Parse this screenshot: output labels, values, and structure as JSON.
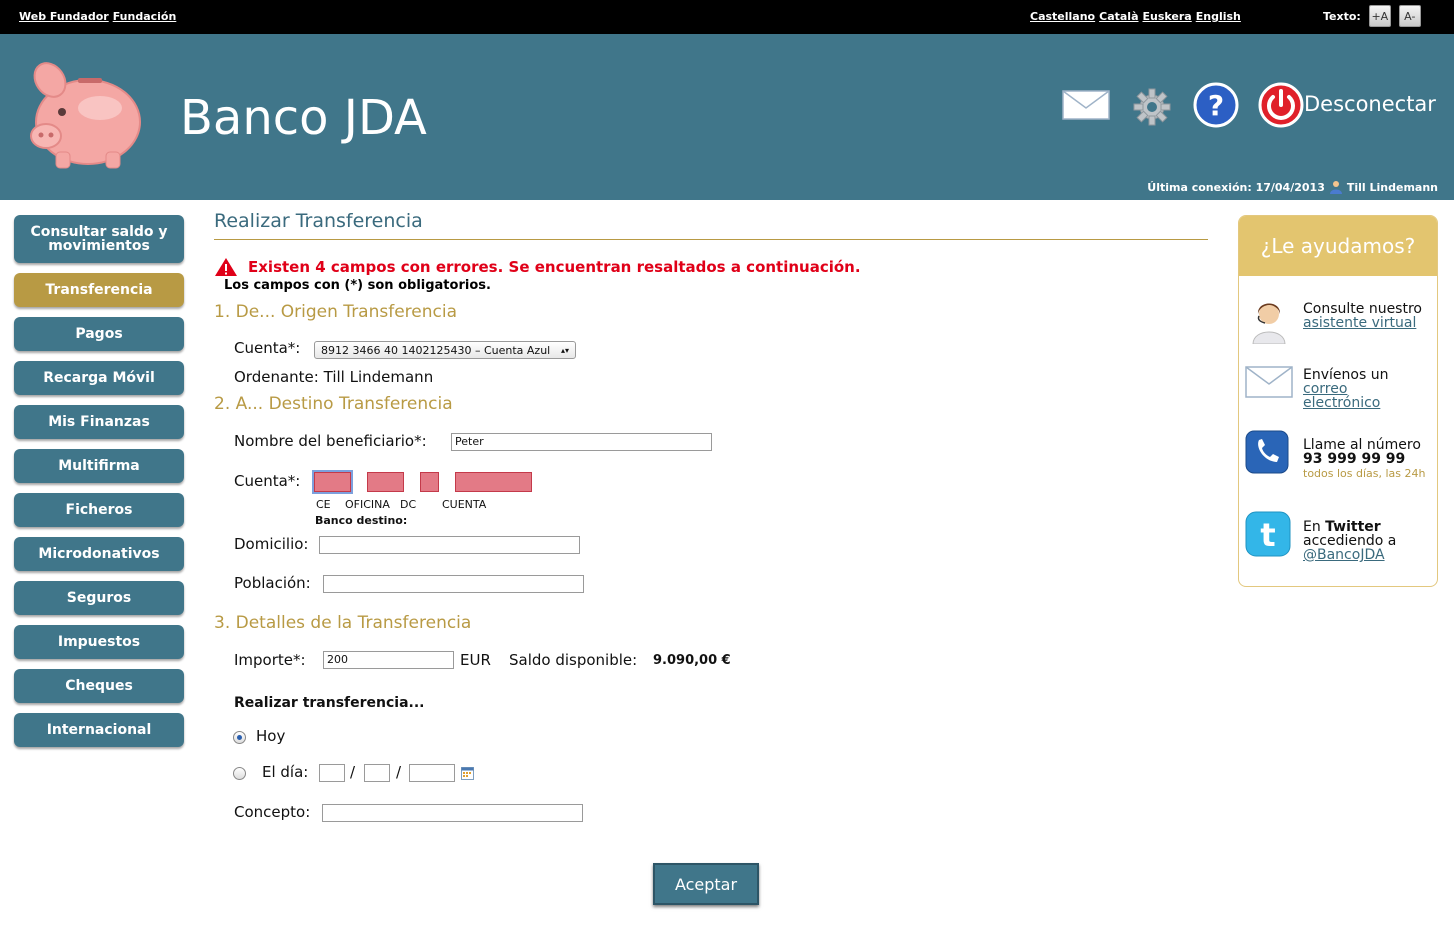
{
  "topbar": {
    "web_label": "Web Fundador",
    "foundation_label": "Fundación",
    "languages": [
      "Castellano",
      "Català",
      "Euskera",
      "English"
    ],
    "text_label": "Texto:",
    "text_increase": "+A",
    "text_decrease": "A-"
  },
  "header": {
    "bank_name": "Banco JDA",
    "logout_label": "Desconectar",
    "last_connection_label": "Última conexión: 17/04/2013",
    "user_name": "Till Lindemann"
  },
  "sidebar": {
    "items": [
      {
        "label": "Consultar saldo y movimientos"
      },
      {
        "label": "Transferencia"
      },
      {
        "label": "Pagos"
      },
      {
        "label": "Recarga Móvil"
      },
      {
        "label": "Mis Finanzas"
      },
      {
        "label": "Multifirma"
      },
      {
        "label": "Ficheros"
      },
      {
        "label": "Microdonativos"
      },
      {
        "label": "Seguros"
      },
      {
        "label": "Impuestos"
      },
      {
        "label": "Cheques"
      },
      {
        "label": "Internacional"
      }
    ],
    "active_index": 1
  },
  "main": {
    "title": "Realizar Transferencia",
    "error_message": "Existen 4 campos con errores. Se encuentran resaltados a continuación.",
    "required_note": "Los campos con (*) son obligatorios.",
    "section1": "1. De... Origen Transferencia",
    "cuenta_label": "Cuenta*:",
    "cuenta_value": "8912 3466 40 1402125430 – Cuenta Azul",
    "ordenante_label": "Ordenante:",
    "ordenante_value": "Till Lindemann",
    "section2": "2. A... Destino Transferencia",
    "beneficiario_label": "Nombre del beneficiario*:",
    "beneficiario_value": "Peter",
    "cuenta_dest_label": "Cuenta*:",
    "cuenta_parts": [
      "CE",
      "OFICINA",
      "DC",
      "CUENTA"
    ],
    "banco_destino_label": "Banco destino:",
    "domicilio_label": "Domicilio:",
    "poblacion_label": "Población:",
    "section3": "3. Detalles de la Transferencia",
    "importe_label": "Importe*:",
    "importe_value": "200",
    "currency": "EUR",
    "saldo_label": "Saldo disponible:",
    "saldo_value": "9.090,00 €",
    "realizar_label": "Realizar transferencia...",
    "hoy_label": "Hoy",
    "el_dia_label": "El día:",
    "date_sep": "/",
    "concepto_label": "Concepto:",
    "accept_label": "Aceptar"
  },
  "help": {
    "title": "¿Le ayudamos?",
    "assistant_text": "Consulte nuestro",
    "assistant_link": "asistente virtual",
    "mail_text": "Envíenos un",
    "mail_link_1": "correo",
    "mail_link_2": "electrónico",
    "phone_text": "Llame al número",
    "phone_number": "93 999 99 99",
    "phone_hours": "todos los días, las 24h",
    "twitter_text_1": "En",
    "twitter_text_2": "Twitter",
    "twitter_text_3": "accediendo a",
    "twitter_link": "@BancoJDA"
  },
  "colors": {
    "header_bg": "#40768a",
    "accent_gold": "#b89a44",
    "error_red": "#e00018",
    "error_field": "#e37a86",
    "help_header": "#e3c56f"
  }
}
